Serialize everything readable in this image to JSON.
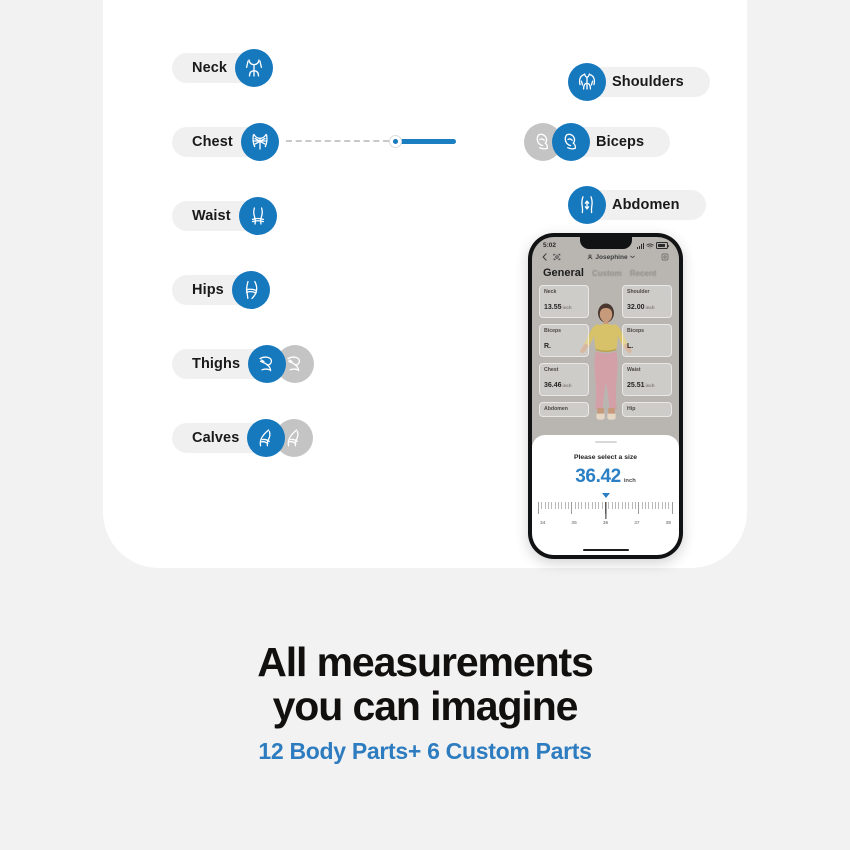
{
  "theme": {
    "page_background": "#f2f2f2",
    "card_background": "#ffffff",
    "accent_blue": "#1678bd",
    "inactive_gray": "#c4c4c4",
    "pill_background": "#f0f0f0",
    "subheadline_color": "#2e7cc0"
  },
  "body_parts": {
    "left_column": [
      {
        "label": "Neck",
        "icon": "neck-icon",
        "active": true,
        "has_inactive_twin": false
      },
      {
        "label": "Chest",
        "icon": "chest-icon",
        "active": true,
        "has_inactive_twin": false
      },
      {
        "label": "Waist",
        "icon": "waist-icon",
        "active": true,
        "has_inactive_twin": false
      },
      {
        "label": "Hips",
        "icon": "hips-icon",
        "active": true,
        "has_inactive_twin": false
      },
      {
        "label": "Thighs",
        "icon": "thigh-icon",
        "active": true,
        "has_inactive_twin": true
      },
      {
        "label": "Calves",
        "icon": "calf-icon",
        "active": true,
        "has_inactive_twin": true
      }
    ],
    "right_column": [
      {
        "label": "Shoulders",
        "icon": "shoulders-icon",
        "active": true,
        "has_inactive_twin": false
      },
      {
        "label": "Biceps",
        "icon": "biceps-icon",
        "active": true,
        "has_inactive_twin": true
      },
      {
        "label": "Abdomen",
        "icon": "abdomen-icon",
        "active": true,
        "has_inactive_twin": false
      }
    ]
  },
  "slider": {
    "name": "chest-measurement-slider",
    "fill_percent": 40
  },
  "phone": {
    "status_bar": {
      "time": "5:02",
      "signal_icon": "cellular-bars-icon",
      "wifi_icon": "wifi-icon",
      "battery_icon": "battery-icon"
    },
    "nav": {
      "back_icon": "chevron-left-icon",
      "scan_icon": "scan-icon",
      "profile_icon": "person-icon",
      "title": "Josephine",
      "dropdown_icon": "chevron-down-icon",
      "settings_icon": "settings-icon"
    },
    "tabs": [
      {
        "label": "General",
        "selected": true
      },
      {
        "label": "Custom",
        "selected": false
      },
      {
        "label": "Recent",
        "selected": false
      }
    ],
    "measurements": [
      {
        "label": "Neck",
        "value": "13.55",
        "unit": "inch"
      },
      {
        "label": "Shoulder",
        "value": "32.00",
        "unit": "inch"
      },
      {
        "label": "Biceps",
        "value": "R.",
        "unit": ""
      },
      {
        "label": "Biceps",
        "value": "L.",
        "unit": ""
      },
      {
        "label": "Chest",
        "value": "36.46",
        "unit": "inch"
      },
      {
        "label": "Waist",
        "value": "25.51",
        "unit": "inch"
      },
      {
        "label": "Abdomen",
        "value": "",
        "unit": ""
      },
      {
        "label": "Hip",
        "value": "",
        "unit": ""
      }
    ],
    "sheet": {
      "title": "Please select a size",
      "value": "36.42",
      "unit": "inch",
      "caret_icon": "caret-down-icon",
      "ruler_labels": [
        "34",
        "35",
        "36",
        "37",
        "38"
      ]
    }
  },
  "headline": {
    "line1": "All measurements",
    "line2": "you can imagine"
  },
  "subheadline": "12 Body Parts+ 6 Custom Parts"
}
